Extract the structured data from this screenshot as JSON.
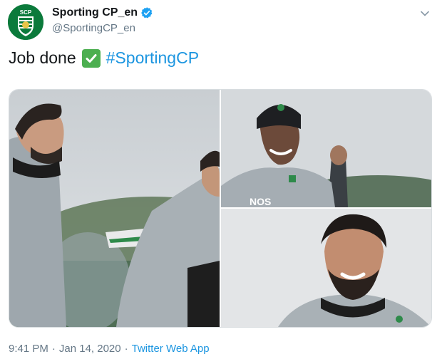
{
  "account": {
    "display_name": "Sporting CP_en",
    "handle": "@SportingCP_en",
    "avatar_text": "SCP"
  },
  "tweet": {
    "text": "Job done",
    "hashtag": "#SportingCP"
  },
  "media": {
    "photo_count": 3,
    "jersey_text": "NOS"
  },
  "meta": {
    "time": "9:41 PM",
    "separator1": "·",
    "date": "Jan 14, 2020",
    "separator2": "·",
    "source": "Twitter Web App"
  },
  "colors": {
    "link": "#1b95e0",
    "verified": "#1da1f2",
    "brand_green": "#0b7a3b",
    "check_green": "#4caf50"
  },
  "icons": [
    "verified-badge-icon",
    "chevron-down-icon",
    "check-mark-icon"
  ]
}
